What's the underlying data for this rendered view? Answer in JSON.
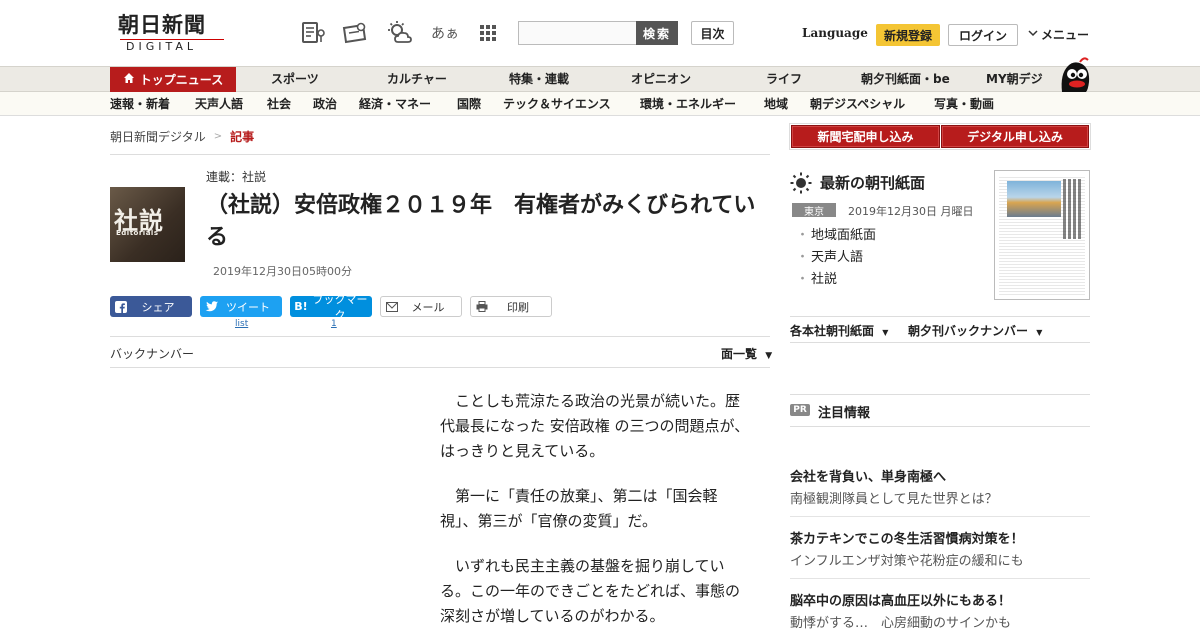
{
  "header": {
    "logo_ja": "朝日新聞",
    "logo_en": "DIGITAL",
    "search_button": "検索",
    "search_placeholder": "",
    "toc_button": "目次",
    "language": "Language",
    "signup": "新規登録",
    "login": "ログイン",
    "menu": "メニュー",
    "icons": [
      "report-icon",
      "coupon-icon",
      "weather-icon",
      "font-size-icon",
      "apps-grid-icon"
    ],
    "font_size_glyph": "あぁ"
  },
  "nav_main": {
    "top_news": "トップニュース",
    "items": [
      "スポーツ",
      "カルチャー",
      "特集・連載",
      "オピニオン",
      "ライフ",
      "朝夕刊紙面・be",
      "MY朝デジ"
    ]
  },
  "nav_sub": {
    "items": [
      "速報・新着",
      "天声人語",
      "社会",
      "政治",
      "経済・マネー",
      "国際",
      "テック＆サイエンス",
      "環境・エネルギー",
      "地域",
      "朝デジスペシャル",
      "写真・動画"
    ]
  },
  "breadcrumb": {
    "home": "朝日新聞デジタル",
    "sep": ">",
    "current": "記事"
  },
  "article": {
    "thumb_big": "社説",
    "thumb_small": "Editorials",
    "series": "連載：社説",
    "title": "（社説）安倍政権２０１９年　有権者がみくびられている",
    "date": "2019年12月30日05時00分",
    "backnumber": "バックナンバー",
    "all_view": "面一覧",
    "paragraphs": [
      "ことしも荒涼たる政治の光景が続いた。歴代最長になった 安倍政権 の三つの問題点が、はっきりと見えている。",
      "第一に「責任の放棄」、第二は「国会軽視」、第三が「官僚の変質」だ。",
      "いずれも民主主義の基盤を掘り崩している。この一年のできごとをたどれば、事態の深刻さが増しているのがわかる。"
    ]
  },
  "share": {
    "facebook": "シェア",
    "twitter": "ツイート",
    "twitter_count": "list",
    "hatena": "ブックマーク",
    "hatena_icon": "B!",
    "hatena_count": "1",
    "mail": "メール",
    "print": "印刷"
  },
  "sidebar": {
    "btn_paper": "新聞宅配申し込み",
    "btn_digital": "デジタル申し込み",
    "paper_title": "最新の朝刊紙面",
    "region": "東京",
    "paper_date": "2019年12月30日 月曜日",
    "paper_links": [
      "地域面紙面",
      "天声人語",
      "社説"
    ],
    "sub_nav_1": "各本社朝刊紙面",
    "sub_nav_2": "朝夕刊バックナンバー",
    "pr_badge": "PR",
    "pr_title": "注目情報",
    "pr_items": [
      {
        "title": "会社を背負い、単身南極へ",
        "sub": "南極観測隊員として見た世界とは？"
      },
      {
        "title": "茶カテキンでこの冬生活習慣病対策を！",
        "sub": "インフルエンザ対策や花粉症の緩和にも"
      },
      {
        "title": "脳卒中の原因は高血圧以外にもある！",
        "sub": "動悸がする…　心房細動のサインかも"
      }
    ]
  },
  "colors": {
    "brand_red": "#b71c1c",
    "signup_yellow": "#f4c534",
    "facebook": "#3b5998",
    "twitter": "#1da1f2",
    "hatena": "#008fde"
  }
}
